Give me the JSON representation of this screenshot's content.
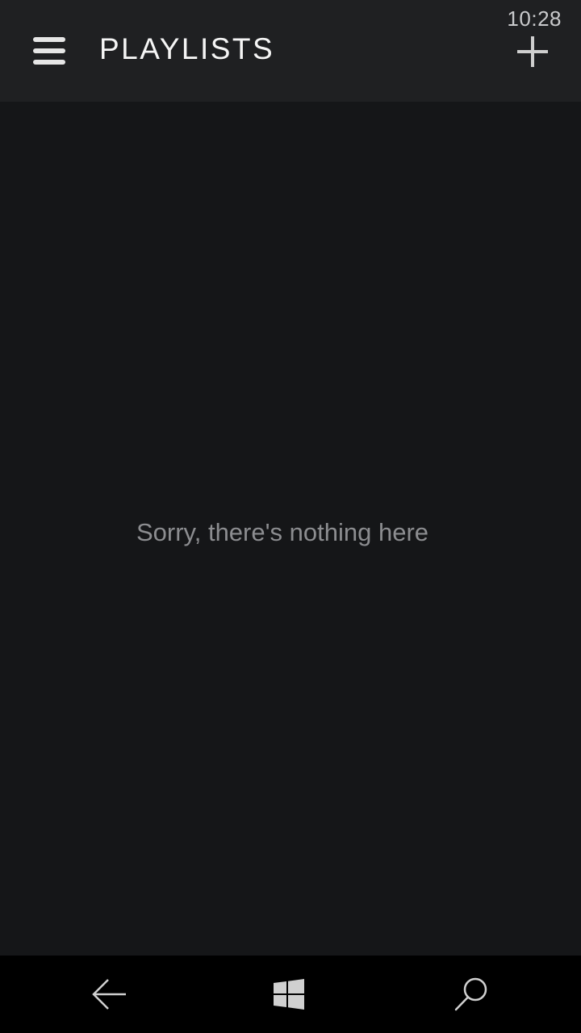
{
  "status_bar": {
    "time": "10:28"
  },
  "header": {
    "title": "PLAYLISTS",
    "menu_icon": "hamburger-menu-icon",
    "add_icon": "plus-icon"
  },
  "main": {
    "empty_message": "Sorry, there's nothing here"
  },
  "navbar": {
    "back_icon": "back-arrow-icon",
    "home_icon": "windows-logo-icon",
    "search_icon": "search-icon"
  },
  "colors": {
    "background": "#151618",
    "header_background": "#1f2022",
    "navbar_background": "#000000",
    "title_text": "#f5f5f5",
    "muted_text": "#8c8d90"
  }
}
